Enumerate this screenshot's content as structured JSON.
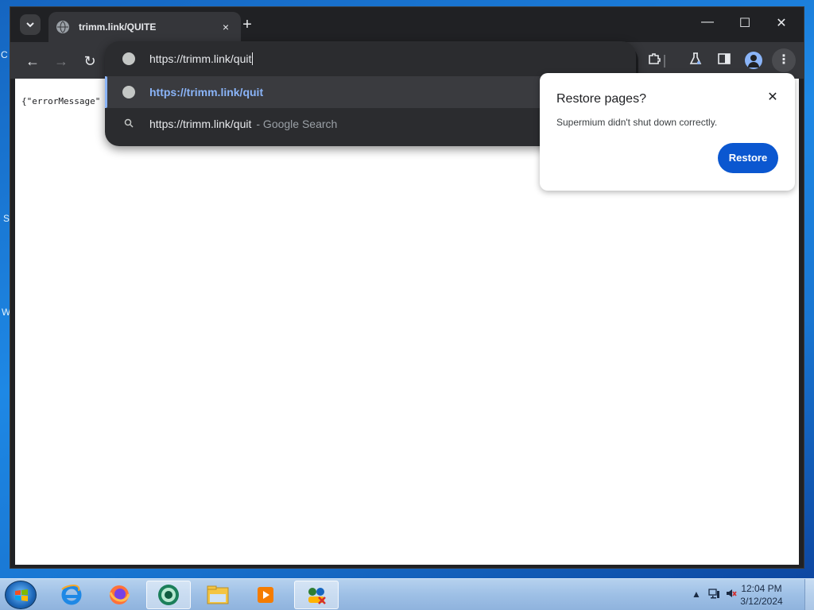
{
  "desktop": {
    "edge_fragments": [
      "C",
      "S",
      "W"
    ]
  },
  "browser": {
    "tab": {
      "title": "trimm.link/QUITE",
      "close": "×",
      "favicon": "globe-icon"
    },
    "new_tab": "+",
    "window_controls": {
      "minimize": "—",
      "maximize": "☐",
      "close": "✕"
    },
    "nav": {
      "back": "←",
      "forward": "→",
      "reload": "↻"
    },
    "toolbar_icons": {
      "extensions": "extensions-icon",
      "labs": "flask-icon",
      "side_panel": "side-panel-icon",
      "profile": "profile-icon",
      "menu": "⋮"
    }
  },
  "omnibox": {
    "input_value": "https://trimm.link/quit",
    "suggestions": [
      {
        "icon": "globe-icon",
        "text": "https://trimm.link/quit",
        "secondary": ""
      },
      {
        "icon": "search-icon",
        "text": "https://trimm.link/quit",
        "secondary": "- Google Search"
      }
    ]
  },
  "page": {
    "json_text": "{\"errorMessage\""
  },
  "restore_dialog": {
    "title": "Restore pages?",
    "message": "Supermium didn't shut down correctly.",
    "close": "✕",
    "button": "Restore"
  },
  "taskbar": {
    "apps": [
      "internet-explorer-icon",
      "firefox-icon",
      "supermium-icon",
      "file-explorer-icon",
      "media-player-icon",
      "network-app-icon"
    ],
    "clock_time": "12:04 PM",
    "clock_date": "3/12/2024"
  },
  "colors": {
    "accent_blue": "#0b57d0",
    "omnibox_highlight": "#8ab4f8",
    "browser_dark": "#202124"
  }
}
